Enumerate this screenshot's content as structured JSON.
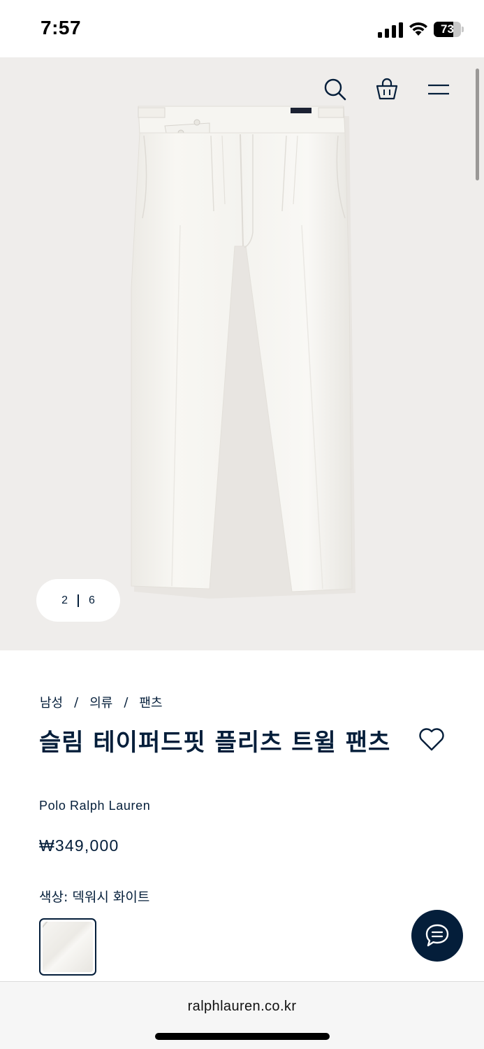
{
  "status_bar": {
    "time": "7:57",
    "battery_level": "73",
    "battery_fraction": 0.73
  },
  "header": {
    "icons": [
      "search-icon",
      "shopping-bag-icon",
      "menu-icon"
    ]
  },
  "gallery": {
    "current_page": "2",
    "total_pages": "6"
  },
  "breadcrumb": {
    "items": [
      "남성",
      "의류",
      "팬츠"
    ],
    "separator": "/"
  },
  "product": {
    "title": "슬림 테이퍼드핏 플리츠 트윌 팬츠",
    "brand": "Polo Ralph Lauren",
    "price": "₩349,000",
    "color_label": "색상: 덱워시 화이트",
    "swatch_color": "#f3f2ee"
  },
  "browser": {
    "url": "ralphlauren.co.kr"
  },
  "colors": {
    "navy": "#041e3a",
    "hero_background": "#efedeb",
    "pants": "#f7f6f2"
  }
}
